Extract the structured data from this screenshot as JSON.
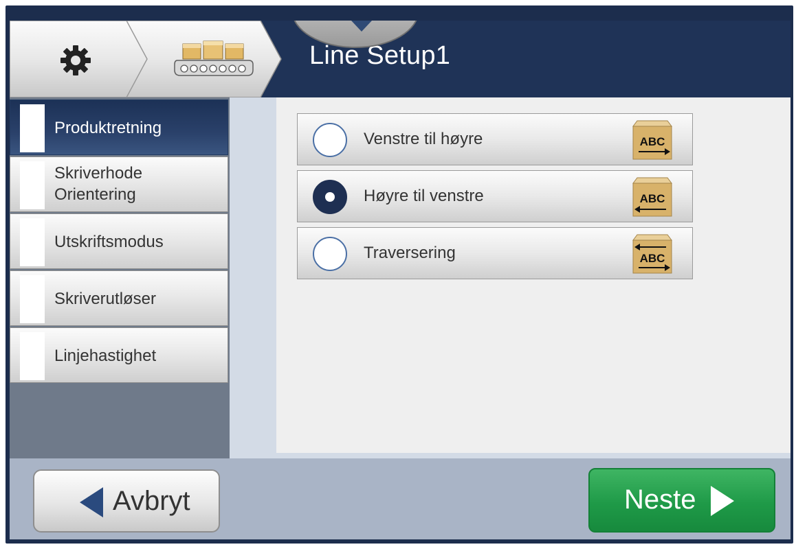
{
  "header": {
    "title": "Line Setup1",
    "icons": {
      "home": "gear-icon",
      "section": "conveyor-boxes-icon",
      "pulldown": "chevron-down-icon"
    }
  },
  "nav": {
    "items": [
      {
        "label": "Produktretning",
        "active": true
      },
      {
        "label": "Skriverhode\nOrientering",
        "active": false
      },
      {
        "label": "Utskriftsmodus",
        "active": false
      },
      {
        "label": "Skriverutløser",
        "active": false
      },
      {
        "label": "Linjehastighet",
        "active": false
      }
    ]
  },
  "options": [
    {
      "label": "Venstre til høyre",
      "selected": false,
      "icon": "box-abc-arrow-right-icon",
      "box_text": "ABC"
    },
    {
      "label": "Høyre til venstre",
      "selected": true,
      "icon": "box-abc-arrow-left-icon",
      "box_text": "ABC"
    },
    {
      "label": "Traversering",
      "selected": false,
      "icon": "box-abc-arrows-both-icon",
      "box_text": "ABC"
    }
  ],
  "footer": {
    "cancel_label": "Avbryt",
    "next_label": "Neste"
  },
  "colors": {
    "header": "#1f3357",
    "active_nav": "#1c3156",
    "next_button": "#1f9a48",
    "footer": "#a9b4c6"
  }
}
